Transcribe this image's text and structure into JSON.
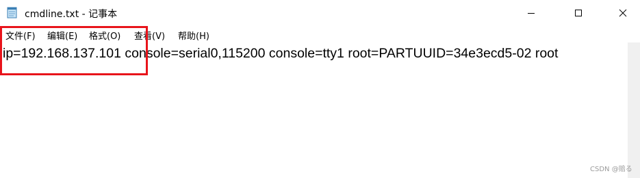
{
  "window": {
    "title": "cmdline.txt - 记事本",
    "app_icon": "notepad-icon",
    "controls": {
      "minimize_icon": "minimize-icon",
      "maximize_icon": "maximize-icon",
      "close_icon": "close-icon"
    }
  },
  "menubar": {
    "items": [
      {
        "label": "文件(F)"
      },
      {
        "label": "编辑(E)"
      },
      {
        "label": "格式(O)"
      },
      {
        "label": "查看(V)"
      },
      {
        "label": "帮助(H)"
      }
    ]
  },
  "editor": {
    "content": "ip=192.168.137.101 console=serial0,115200 console=tty1 root=PARTUUID=34e3ecd5-02 root"
  },
  "annotation": {
    "highlight_color": "#e8141b"
  },
  "watermark": {
    "text": "CSDN @赔る"
  }
}
